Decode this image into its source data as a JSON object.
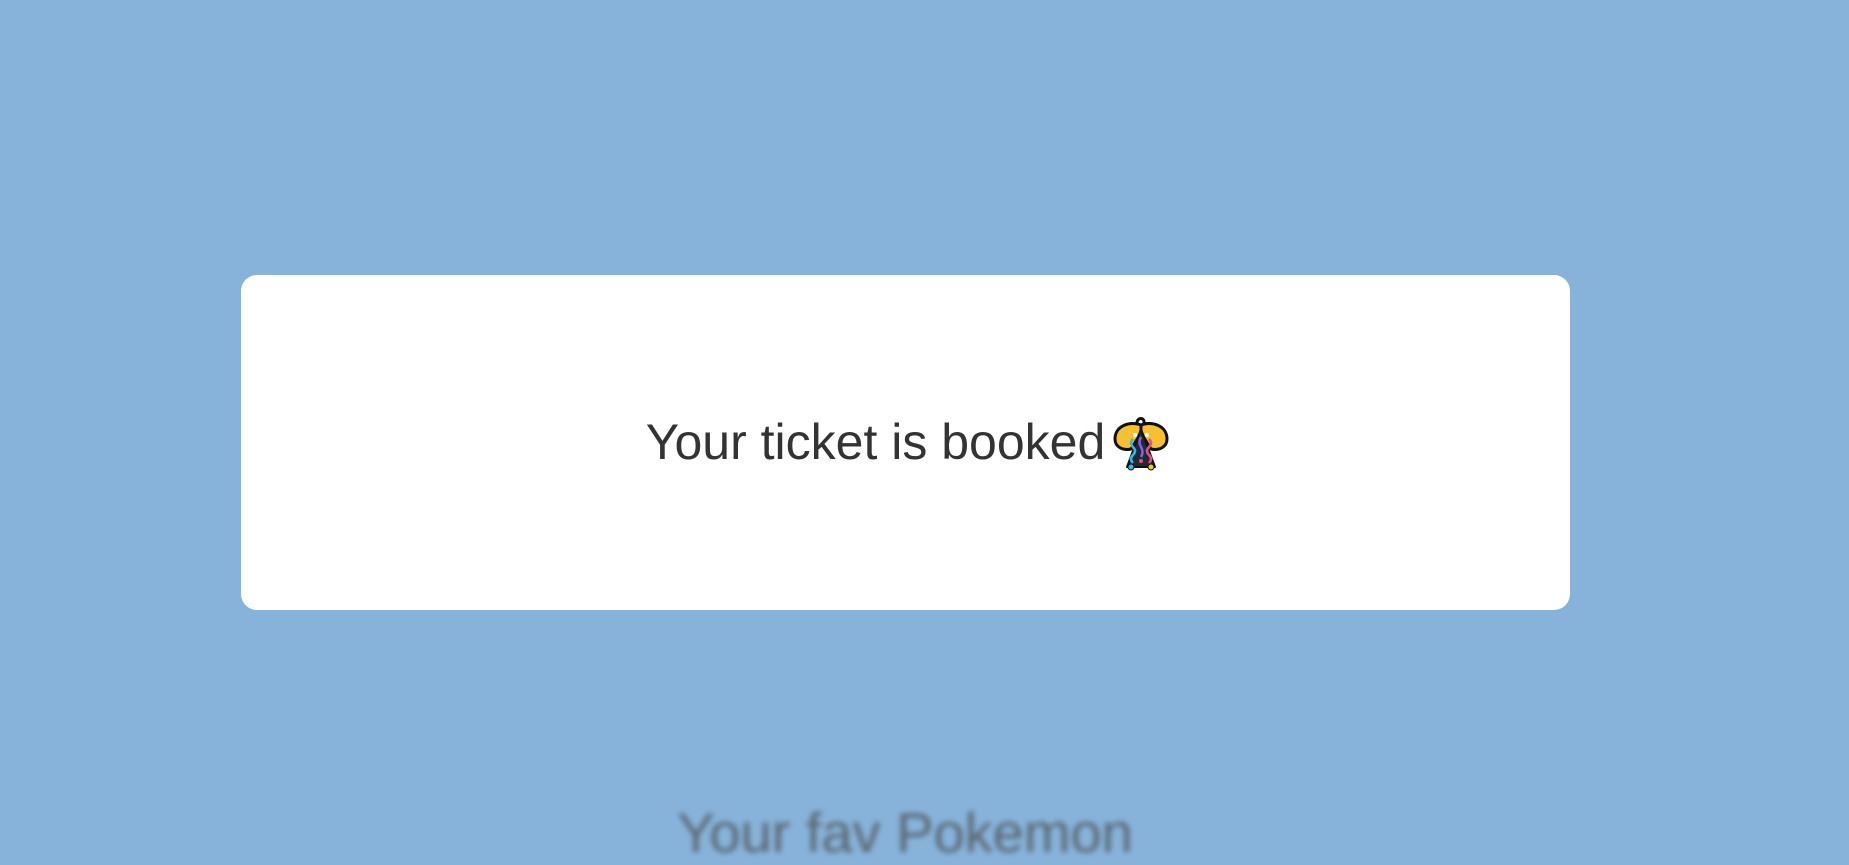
{
  "background_color": "#87b3db",
  "modal": {
    "message": "Your ticket is booked",
    "icon": "party-popper-icon"
  },
  "background_page": {
    "heading": "Your fav Pokemon"
  }
}
